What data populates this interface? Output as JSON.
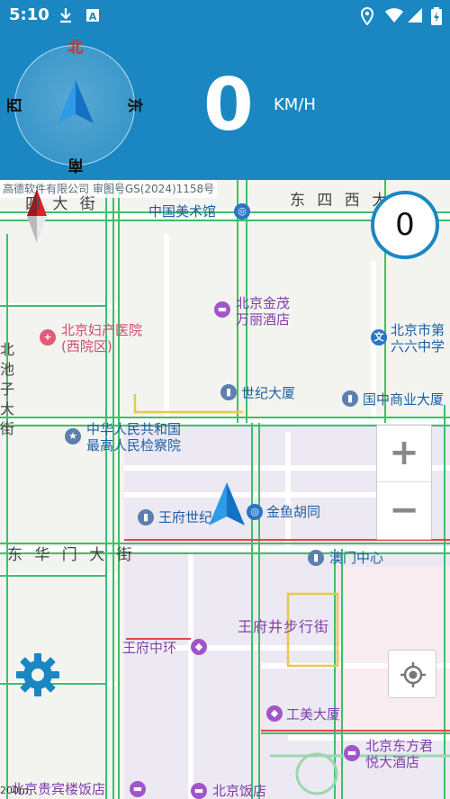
{
  "status_bar": {
    "time": "5:10",
    "icons": [
      "download-icon",
      "app-a-icon",
      "location-pin-icon",
      "wifi-icon",
      "signal-icon",
      "battery-icon"
    ]
  },
  "compass": {
    "north": "北",
    "east": "东",
    "south": "南",
    "west": "西"
  },
  "speedometer": {
    "value": "0",
    "unit": "KM/H"
  },
  "map": {
    "copyright": "高德软件有限公司 审图号GS(2024)1158号",
    "speed_limit": "0",
    "roads": {
      "top_left": "四 大 街",
      "top_right": "东 四 西 大",
      "middle": "东 华 门 大 街",
      "left_vertical": "北 池 子 大 街"
    },
    "pois": {
      "art_museum": "中国美术馆",
      "jinmao": "北京金茂\n万丽酒店",
      "maternity": "北京妇产医院\n(西院区)",
      "bank_right": "北京市第\n六六中学",
      "century": "世纪大厦",
      "guozhong": "国中商业大厦",
      "procuratorate": "中华人民共和国\n最高人民检察院",
      "wangfu_world": "王府世纪",
      "jinyu": "金鱼胡同",
      "macao": "澳门中心",
      "pedestrian": "王府井步行街",
      "wangfu_ring": "王府中环",
      "gongmei": "工美大厦",
      "oriental": "北京东方君\n悦大酒店",
      "guibin": "北京贵宾楼饭店",
      "beijing_hotel": "北京饭店"
    },
    "zoom_in": "+",
    "zoom_out": "−",
    "scale": "200m"
  }
}
